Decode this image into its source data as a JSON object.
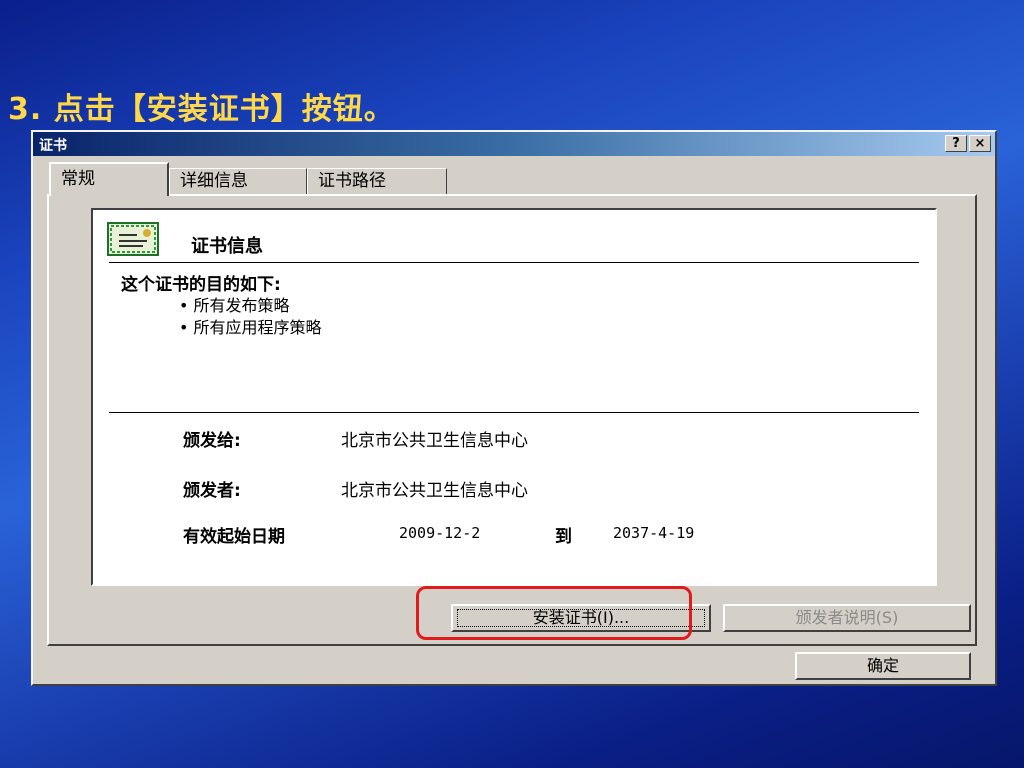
{
  "slide": {
    "title": "3. 点击【安装证书】按钮。"
  },
  "dialog": {
    "title": "证书",
    "help_label": "?",
    "close_label": "×",
    "tabs": [
      {
        "label": "常规"
      },
      {
        "label": "详细信息"
      },
      {
        "label": "证书路径"
      }
    ],
    "cert_info": {
      "heading": "证书信息",
      "purpose_title": "这个证书的目的如下:",
      "purposes": [
        "• 所有发布策略",
        "• 所有应用程序策略"
      ],
      "issued_to_label": "颁发给:",
      "issued_to_value": "北京市公共卫生信息中心",
      "issued_by_label": "颁发者:",
      "issued_by_value": "北京市公共卫生信息中心",
      "valid_from_label": "有效起始日期",
      "valid_from_value": "2009-12-2",
      "to_label": "到",
      "valid_to_value": "2037-4-19"
    },
    "buttons": {
      "install": "安装证书(I)...",
      "issuer_statement": "颁发者说明(S)",
      "ok": "确定"
    }
  },
  "colors": {
    "highlight": "#e11b1b",
    "slide_title": "#ffd84a"
  }
}
